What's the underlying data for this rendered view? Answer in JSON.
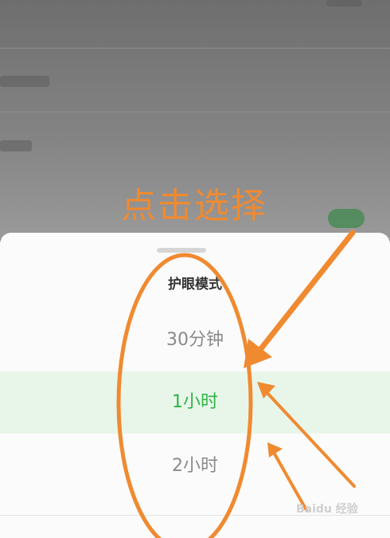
{
  "annotation": {
    "label": "点击选择",
    "color": "#f08a30"
  },
  "sheet": {
    "title": "护眼模式",
    "options": [
      {
        "label": "30分钟",
        "selected": false
      },
      {
        "label": "1小时",
        "selected": true
      },
      {
        "label": "2小时",
        "selected": false
      }
    ],
    "selected_color": "#2fb345"
  },
  "watermark": {
    "text": "Baidu 经验"
  }
}
